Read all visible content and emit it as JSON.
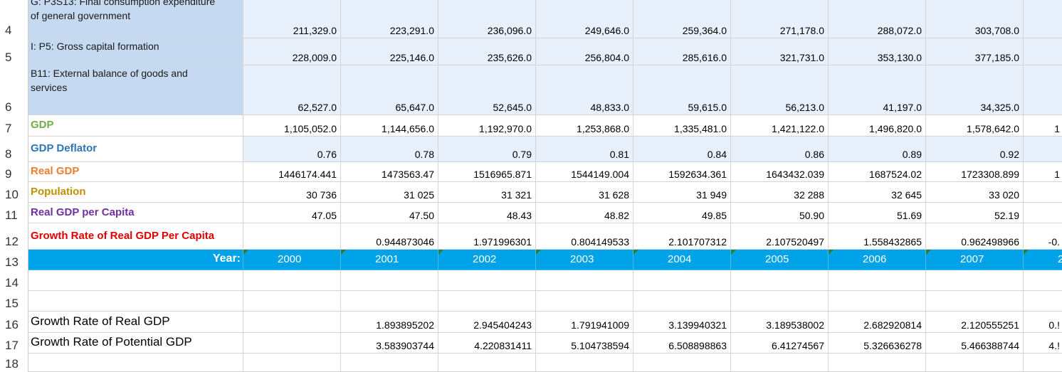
{
  "rows": [
    {
      "num": "4",
      "label_line1": "G: P3S13: Final consumption expenditure",
      "label_line2": "of general government",
      "values": [
        "211,329.0",
        "223,291.0",
        "236,096.0",
        "249,646.0",
        "259,364.0",
        "271,178.0",
        "288,072.0",
        "303,708.0"
      ],
      "extra": ""
    },
    {
      "num": "5",
      "label_line1": "I: P5: Gross capital formation",
      "label_line2": "",
      "values": [
        "228,009.0",
        "225,146.0",
        "235,626.0",
        "256,804.0",
        "285,616.0",
        "321,731.0",
        "353,130.0",
        "377,185.0"
      ],
      "extra": ""
    },
    {
      "num": "6",
      "label_line1": "B11: External balance of goods and",
      "label_line2": "services",
      "values": [
        "62,527.0",
        "65,647.0",
        "52,645.0",
        "48,833.0",
        "59,615.0",
        "56,213.0",
        "41,197.0",
        "34,325.0"
      ],
      "extra": ""
    },
    {
      "num": "7",
      "label": "GDP",
      "color": "#70ad47",
      "values": [
        "1,105,052.0",
        "1,144,656.0",
        "1,192,970.0",
        "1,253,868.0",
        "1,335,481.0",
        "1,421,122.0",
        "1,496,820.0",
        "1,578,642.0"
      ],
      "extra": "1"
    },
    {
      "num": "8",
      "label": "GDP Deflator",
      "color": "#2e75b6",
      "values": [
        "0.76",
        "0.78",
        "0.79",
        "0.81",
        "0.84",
        "0.86",
        "0.89",
        "0.92"
      ],
      "extra": ""
    },
    {
      "num": "9",
      "label": "Real GDP",
      "color": "#ed7d31",
      "values": [
        "1446174.441",
        "1473563.47",
        "1516965.871",
        "1544149.004",
        "1592634.361",
        "1643432.039",
        "1687524.02",
        "1723308.899"
      ],
      "extra": "1"
    },
    {
      "num": "10",
      "label": "Population",
      "color": "#c09000",
      "values": [
        "30 736",
        "31 025",
        "31 321",
        "31 628",
        "31 949",
        "32 288",
        "32 645",
        "33 020"
      ],
      "extra": ""
    },
    {
      "num": "11",
      "label": "Real GDP per Capita",
      "color": "#7030a0",
      "values": [
        "47.05",
        "47.50",
        "48.43",
        "48.82",
        "49.85",
        "50.90",
        "51.69",
        "52.19"
      ],
      "extra": ""
    },
    {
      "num": "12",
      "label": "Growth Rate of Real GDP Per Capita",
      "color": "#e00000",
      "values": [
        "",
        "0.944873046",
        "1.971996301",
        "0.804149533",
        "2.101707312",
        "2.107520497",
        "1.558432865",
        "0.962498966"
      ],
      "extra": "-0."
    },
    {
      "num": "13",
      "label": "Year:",
      "values": [
        "2000",
        "2001",
        "2002",
        "2003",
        "2004",
        "2005",
        "2006",
        "2007"
      ],
      "extra": "2"
    },
    {
      "num": "14"
    },
    {
      "num": "15"
    },
    {
      "num": "16",
      "label": "Growth Rate of Real GDP",
      "values": [
        "",
        "1.893895202",
        "2.945404243",
        "1.791941009",
        "3.139940321",
        "3.189538002",
        "2.682920814",
        "2.120555251"
      ],
      "extra": "0.!"
    },
    {
      "num": "17",
      "label": "Growth Rate of Potential GDP",
      "values": [
        "",
        "3.583903744",
        "4.220831411",
        "5.104738594",
        "6.508898863",
        "6.41274567",
        "5.326636278",
        "5.466388744"
      ],
      "extra": "4.!"
    },
    {
      "num": "18"
    }
  ]
}
